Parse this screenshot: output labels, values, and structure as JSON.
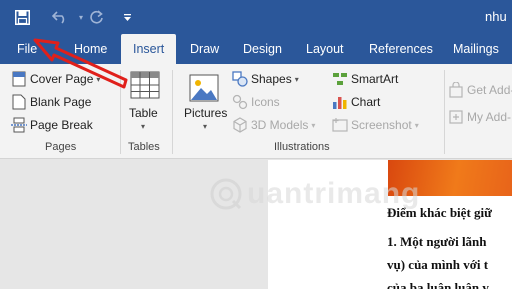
{
  "window": {
    "title_partial": "nhu"
  },
  "quick_access": {
    "save": "save-icon",
    "undo": "undo-icon",
    "redo": "redo-icon",
    "customize": "customize-icon"
  },
  "tabs": [
    {
      "label": "File"
    },
    {
      "label": "Home"
    },
    {
      "label": "Insert",
      "active": true
    },
    {
      "label": "Draw"
    },
    {
      "label": "Design"
    },
    {
      "label": "Layout"
    },
    {
      "label": "References"
    },
    {
      "label": "Mailings"
    }
  ],
  "ribbon": {
    "pages": {
      "label": "Pages",
      "cover_page": "Cover Page",
      "blank_page": "Blank Page",
      "page_break": "Page Break"
    },
    "tables": {
      "label": "Tables",
      "table": "Table"
    },
    "illustrations": {
      "label": "Illustrations",
      "pictures": "Pictures",
      "shapes": "Shapes",
      "icons": "Icons",
      "models_3d": "3D Models",
      "smartart": "SmartArt",
      "chart": "Chart",
      "screenshot": "Screenshot"
    },
    "addins": {
      "get_addins": "Get Add-",
      "my_addins": "My Add-"
    }
  },
  "document": {
    "line1": "Điểm khác biệt giữ",
    "line2": "1. Một người lãnh",
    "line3": "vụ) của mình với t",
    "line4": "của ba luận luận v"
  },
  "watermark": {
    "text": "uantrimang"
  },
  "colors": {
    "title_bar": "#2b579a",
    "ribbon": "#f3f3f3",
    "arrow": "#e0201b"
  }
}
